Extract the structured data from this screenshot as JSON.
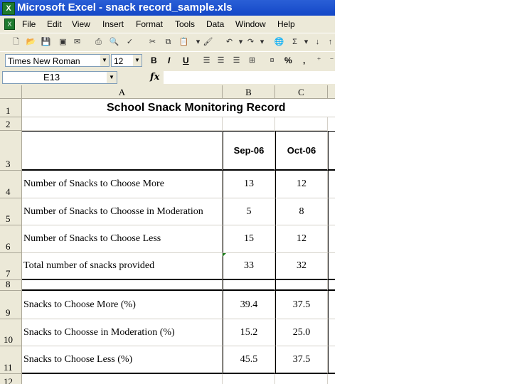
{
  "window": {
    "title": "Microsoft Excel - snack record_sample.xls"
  },
  "menu": [
    "File",
    "Edit",
    "View",
    "Insert",
    "Format",
    "Tools",
    "Data",
    "Window",
    "Help"
  ],
  "format_toolbar": {
    "font": "Times New Roman",
    "size": "12",
    "bold": "B",
    "italic": "I",
    "underline": "U",
    "percent": "%",
    "comma": ","
  },
  "formula_bar": {
    "name_box": "E13",
    "fx": "fx",
    "formula": ""
  },
  "columns": [
    "A",
    "B",
    "C"
  ],
  "rows": [
    "1",
    "2",
    "3",
    "4",
    "5",
    "6",
    "7",
    "8",
    "9",
    "10",
    "11",
    "12"
  ],
  "sheet": {
    "title": "School Snack Monitoring Record",
    "months": [
      "Sep-06",
      "Oct-06"
    ],
    "data_rows": [
      {
        "label": "Number of Snacks to Choose More",
        "values": [
          "13",
          "12"
        ]
      },
      {
        "label": "Number of Snacks to Choosse in Moderation",
        "values": [
          "5",
          "8"
        ]
      },
      {
        "label": "Number of Snacks to Choose Less",
        "values": [
          "15",
          "12"
        ]
      },
      {
        "label": "Total number of snacks provided",
        "values": [
          "33",
          "32"
        ]
      }
    ],
    "pct_rows": [
      {
        "label": "Snacks to Choose More (%)",
        "values": [
          "39.4",
          "37.5"
        ]
      },
      {
        "label": "Snacks to Choosse in Moderation (%)",
        "values": [
          "15.2",
          "25.0"
        ]
      },
      {
        "label": "Snacks to Choose Less (%)",
        "values": [
          "45.5",
          "37.5"
        ]
      }
    ]
  },
  "colors": {
    "titlebar": "#1447c7",
    "chrome": "#ece9d8",
    "header": "#ece9d8"
  }
}
